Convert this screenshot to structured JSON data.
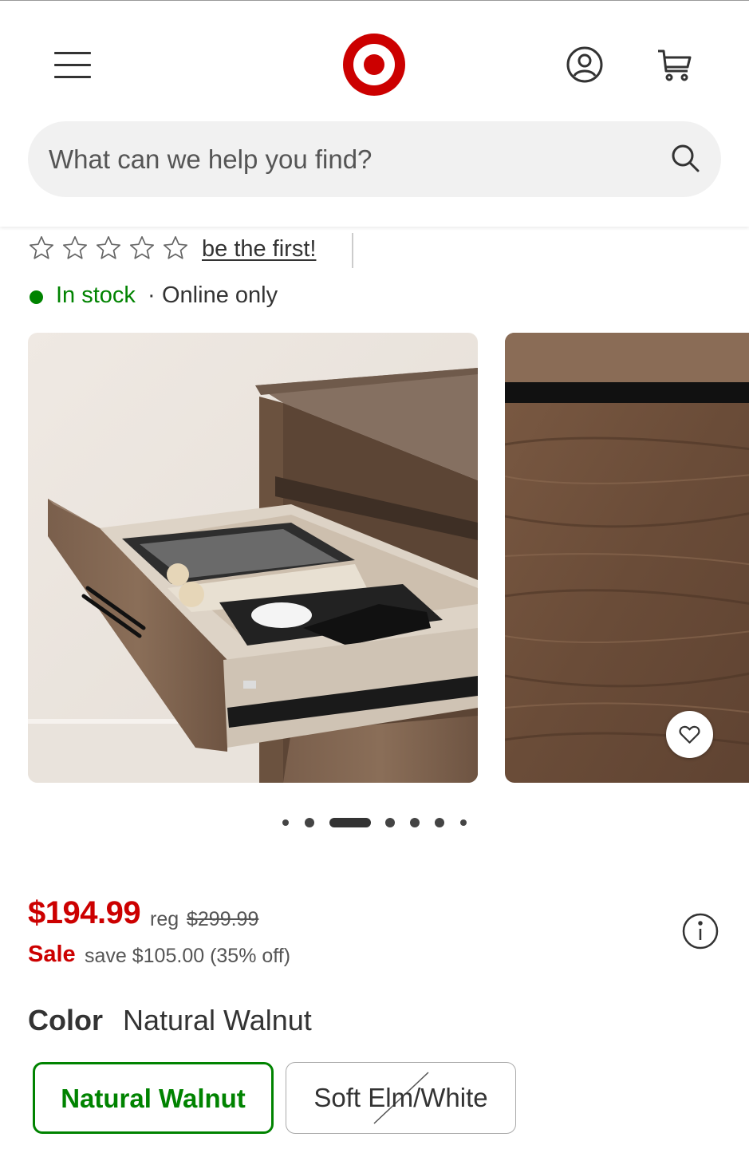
{
  "header": {
    "menu_icon": "hamburger-menu-icon",
    "logo": "target-bullseye-logo",
    "account_icon": "account-icon",
    "cart_icon": "cart-icon",
    "brand_color": "#cc0000"
  },
  "search": {
    "placeholder": "What can we help you find?",
    "icon": "search-icon"
  },
  "rating": {
    "stars_filled": 0,
    "stars_total": 5,
    "link_text": "be the first!"
  },
  "stock": {
    "status": "In stock",
    "separator": "·",
    "availability": "Online only",
    "status_color": "#008300"
  },
  "gallery": {
    "active_index": 2,
    "total_images": 7,
    "favorite_icon": "heart-icon"
  },
  "pricing": {
    "price": "$194.99",
    "reg_label": "reg",
    "reg_price": "$299.99",
    "sale_label": "Sale",
    "save_text": "save $105.00 (35% off)",
    "info_icon": "info-icon",
    "sale_color": "#cc0000"
  },
  "color": {
    "label": "Color",
    "selected": "Natural Walnut",
    "options": [
      {
        "label": "Natural Walnut",
        "selected": true,
        "available": true
      },
      {
        "label": "Soft Elm/White",
        "selected": false,
        "available": false
      }
    ]
  }
}
